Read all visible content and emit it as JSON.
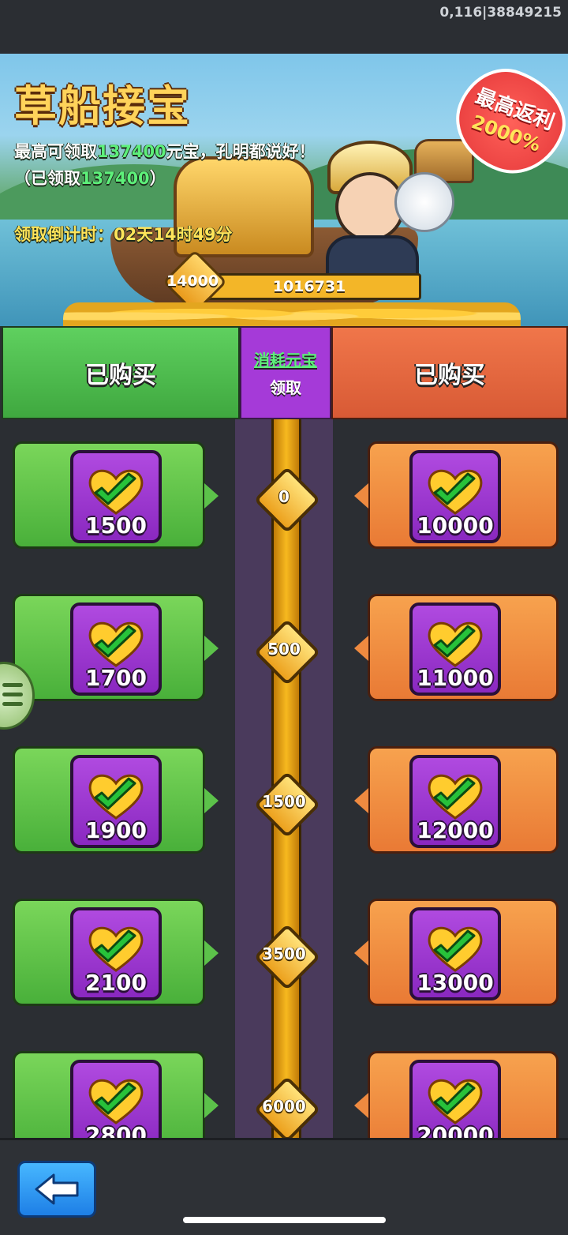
{
  "status": {
    "text": "0,116|38849215"
  },
  "banner": {
    "title": "草船接宝",
    "subtitle_prefix": "最高可领取",
    "subtitle_amount": "137400",
    "subtitle_suffix": "元宝，孔明都说好！",
    "claimed_prefix": "（已领取",
    "claimed_amount": "137400",
    "claimed_suffix": "）",
    "countdown": "领取倒计时：02天14时49分",
    "badge_line1": "最高返利",
    "badge_line2": "2000%",
    "progress_gem_value": "14000",
    "progress_value": "1016731",
    "progress_fraction": 1.0
  },
  "header": {
    "left_label": "已购买",
    "mid_top": "消耗元宝",
    "mid_bottom": "领取",
    "right_label": "已购买"
  },
  "rows": [
    {
      "left": "1500",
      "node": "0",
      "right": "10000"
    },
    {
      "left": "1700",
      "node": "500",
      "right": "11000"
    },
    {
      "left": "1900",
      "node": "1500",
      "right": "12000"
    },
    {
      "left": "2100",
      "node": "3500",
      "right": "13000"
    },
    {
      "left": "2800",
      "node": "6000",
      "right": "20000"
    }
  ],
  "icons": {
    "item": "gold-heart-check-icon",
    "back": "back-arrow-icon",
    "handle": "menu-handle-icon"
  },
  "colors": {
    "left_column": "#5cc24a",
    "right_column": "#ef8a40",
    "mid_column": "#a53ad8",
    "rail": "#f7b91f",
    "highlight_green": "#5df07a"
  }
}
